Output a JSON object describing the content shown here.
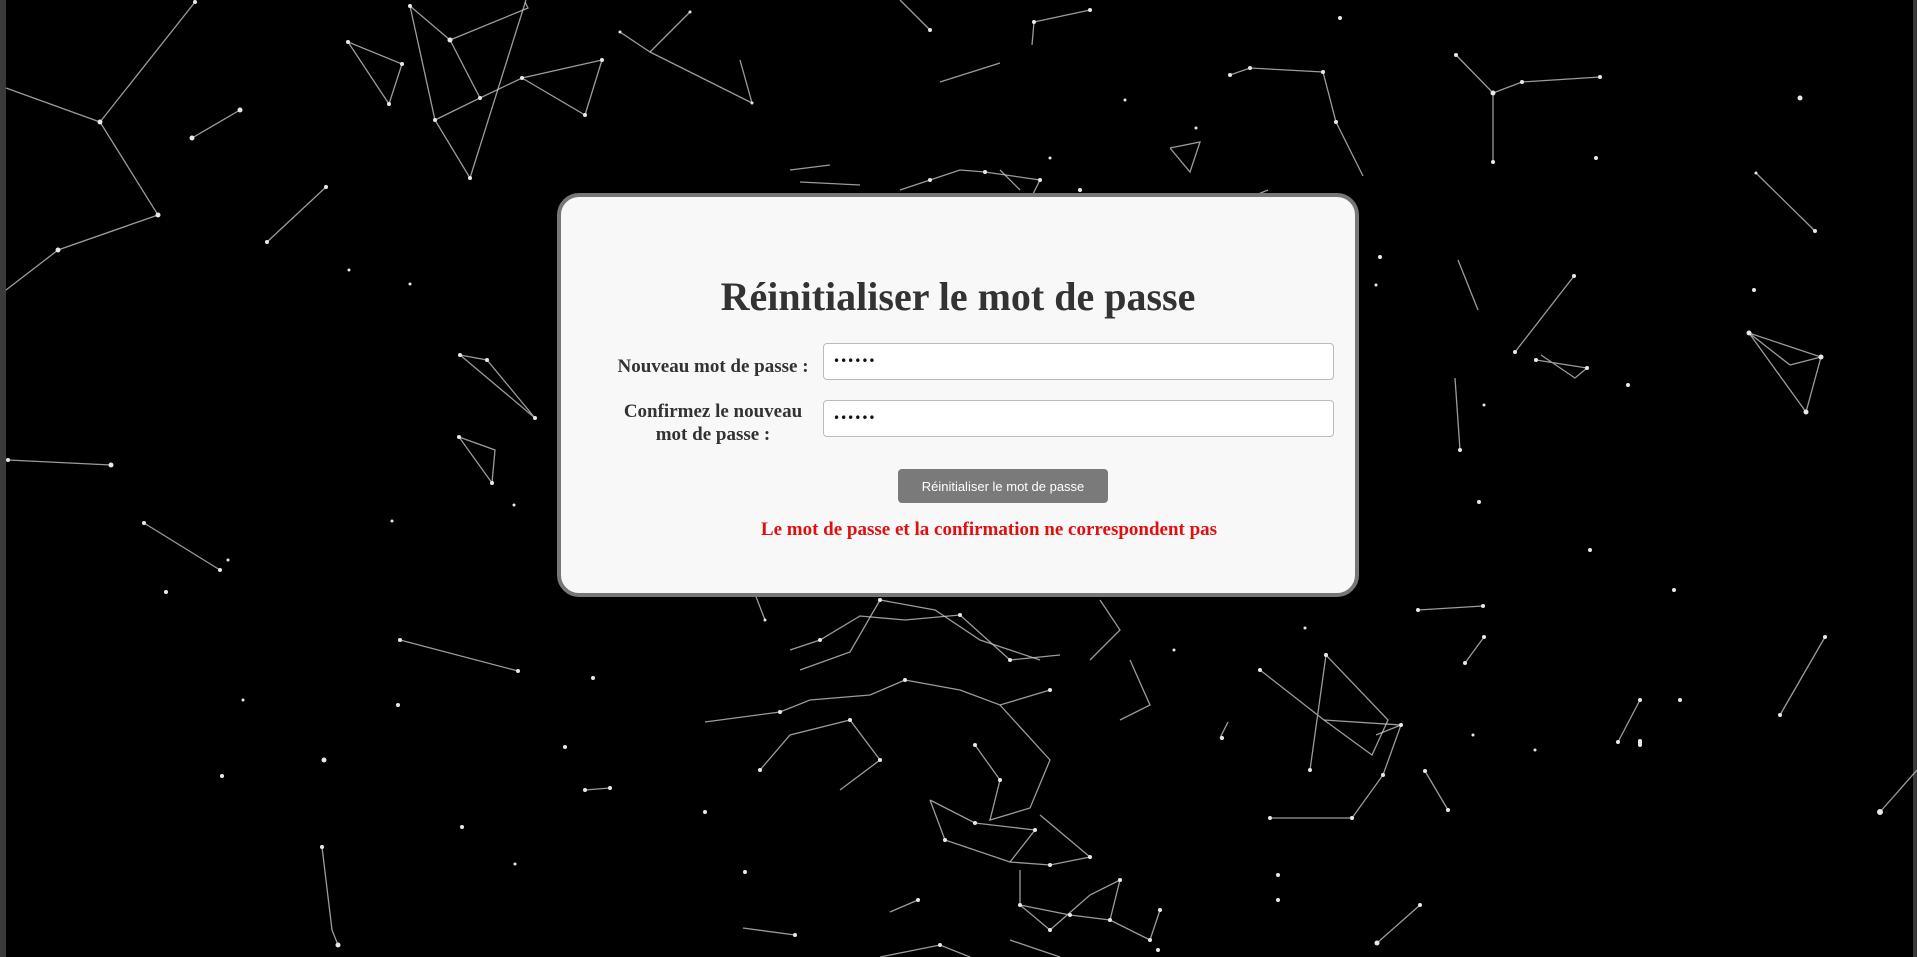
{
  "form": {
    "title": "Réinitialiser le mot de passe",
    "new_password_label": "Nouveau mot de passe :",
    "new_password_value": "••••••",
    "confirm_password_label": "Confirmez le nouveau mot de passe :",
    "confirm_password_value": "••••••",
    "submit_label": "Réinitialiser le mot de passe",
    "error_message": "Le mot de passe et la confirmation ne correspondent pas"
  },
  "colors": {
    "background": "#000000",
    "card": "#f8f8f8",
    "card_border": "#777777",
    "button": "#7a7a7a",
    "error": "#e01010"
  }
}
